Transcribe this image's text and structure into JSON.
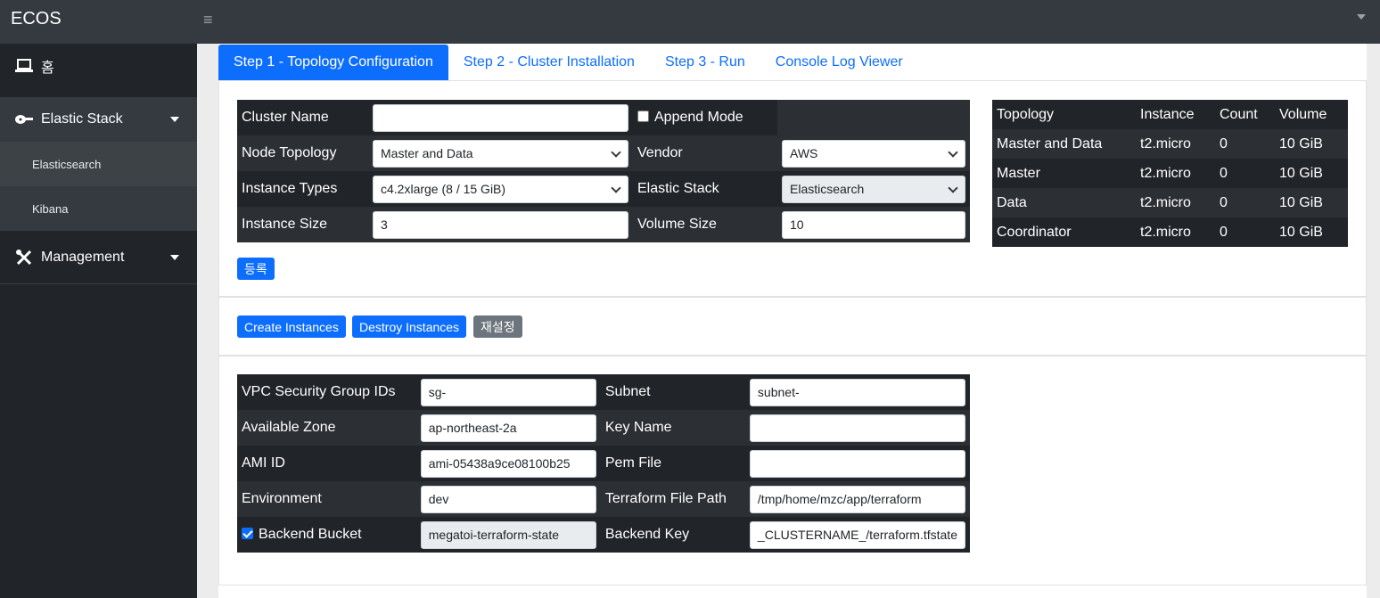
{
  "app": {
    "brand": "ECOS",
    "menu_icon": "≡"
  },
  "sidebar": {
    "home": "홈",
    "elastic_stack": "Elastic Stack",
    "elasticsearch": "Elasticsearch",
    "kibana": "Kibana",
    "management": "Management"
  },
  "tabs": [
    {
      "label": "Step 1 - Topology Configuration",
      "active": true
    },
    {
      "label": "Step 2 - Cluster Installation"
    },
    {
      "label": "Step 3 - Run"
    },
    {
      "label": "Console Log Viewer"
    }
  ],
  "cluster_form": {
    "cluster_name_label": "Cluster Name",
    "cluster_name_value": "",
    "append_mode_label": "Append Mode",
    "append_mode_checked": false,
    "node_topology_label": "Node Topology",
    "node_topology_value": "Master and Data",
    "vendor_label": "Vendor",
    "vendor_value": "AWS",
    "instance_types_label": "Instance Types",
    "instance_types_value": "c4.2xlarge (8 / 15 GiB)",
    "elastic_stack_label": "Elastic Stack",
    "elastic_stack_value": "Elasticsearch",
    "instance_size_label": "Instance Size",
    "instance_size_value": "3",
    "volume_size_label": "Volume Size",
    "volume_size_value": "10",
    "register_button": "등록"
  },
  "topology_table": {
    "headers": [
      "Topology",
      "Instance",
      "Count",
      "Volume"
    ],
    "rows": [
      [
        "Master and Data",
        "t2.micro",
        "0",
        "10 GiB"
      ],
      [
        "Master",
        "t2.micro",
        "0",
        "10 GiB"
      ],
      [
        "Data",
        "t2.micro",
        "0",
        "10 GiB"
      ],
      [
        "Coordinator",
        "t2.micro",
        "0",
        "10 GiB"
      ]
    ]
  },
  "actions": {
    "create": "Create Instances",
    "destroy": "Destroy Instances",
    "reset": "재설정"
  },
  "aws_form": {
    "vpc_label": "VPC Security Group IDs",
    "vpc_value": "sg-",
    "subnet_label": "Subnet",
    "subnet_value": "subnet-",
    "zone_label": "Available Zone",
    "zone_value": "ap-northeast-2a",
    "key_name_label": "Key Name",
    "key_name_value": "",
    "ami_label": "AMI ID",
    "ami_value": "ami-05438a9ce08100b25",
    "pem_label": "Pem File",
    "pem_value": "",
    "env_label": "Environment",
    "env_value": "dev",
    "tf_path_label": "Terraform File Path",
    "tf_path_value": "/tmp/home/mzc/app/terraform",
    "bucket_label": "Backend Bucket",
    "bucket_checked": true,
    "bucket_value": "megatoi-terraform-state",
    "backend_key_label": "Backend Key",
    "backend_key_value": "_CLUSTERNAME_/terraform.tfstate"
  }
}
